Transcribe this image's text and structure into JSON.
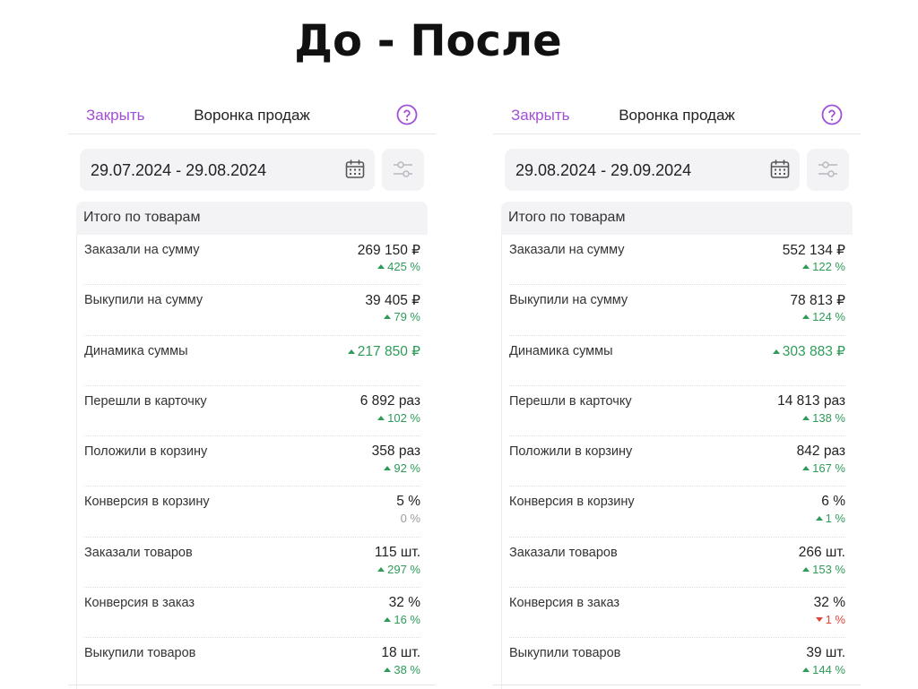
{
  "page_title": "До - После",
  "panels": [
    {
      "close_label": "Закрыть",
      "title": "Воронка продаж",
      "date_range": "29.07.2024 - 29.08.2024",
      "summary_title": "Итого по товарам",
      "rows": [
        {
          "label": "Заказали на сумму",
          "value": "269 150 ₽",
          "delta": "425 %",
          "trend": "up",
          "value_color": "normal"
        },
        {
          "label": "Выкупили на сумму",
          "value": "39 405 ₽",
          "delta": "79 %",
          "trend": "up",
          "value_color": "normal"
        },
        {
          "label": "Динамика суммы",
          "value": "217 850 ₽",
          "delta": "",
          "trend": "up",
          "value_color": "green"
        },
        {
          "label": "Перешли в карточку",
          "value": "6 892 раз",
          "delta": "102 %",
          "trend": "up",
          "value_color": "normal"
        },
        {
          "label": "Положили в корзину",
          "value": "358 раз",
          "delta": "92 %",
          "trend": "up",
          "value_color": "normal"
        },
        {
          "label": "Конверсия в корзину",
          "value": "5 %",
          "delta": "0 %",
          "trend": "none",
          "value_color": "normal"
        },
        {
          "label": "Заказали товаров",
          "value": "115 шт.",
          "delta": "297 %",
          "trend": "up",
          "value_color": "normal"
        },
        {
          "label": "Конверсия в заказ",
          "value": "32 %",
          "delta": "16 %",
          "trend": "up",
          "value_color": "normal"
        },
        {
          "label": "Выкупили товаров",
          "value": "18 шт.",
          "delta": "38 %",
          "trend": "up",
          "value_color": "normal"
        }
      ]
    },
    {
      "close_label": "Закрыть",
      "title": "Воронка продаж",
      "date_range": "29.08.2024 - 29.09.2024",
      "summary_title": "Итого по товарам",
      "rows": [
        {
          "label": "Заказали на сумму",
          "value": "552 134 ₽",
          "delta": "122 %",
          "trend": "up",
          "value_color": "normal"
        },
        {
          "label": "Выкупили на сумму",
          "value": "78 813 ₽",
          "delta": "124 %",
          "trend": "up",
          "value_color": "normal"
        },
        {
          "label": "Динамика суммы",
          "value": "303 883 ₽",
          "delta": "",
          "trend": "up",
          "value_color": "green"
        },
        {
          "label": "Перешли в карточку",
          "value": "14 813 раз",
          "delta": "138 %",
          "trend": "up",
          "value_color": "normal"
        },
        {
          "label": "Положили в корзину",
          "value": "842 раз",
          "delta": "167 %",
          "trend": "up",
          "value_color": "normal"
        },
        {
          "label": "Конверсия в корзину",
          "value": "6 %",
          "delta": "1 %",
          "trend": "up",
          "value_color": "normal"
        },
        {
          "label": "Заказали товаров",
          "value": "266 шт.",
          "delta": "153 %",
          "trend": "up",
          "value_color": "normal"
        },
        {
          "label": "Конверсия в заказ",
          "value": "32 %",
          "delta": "1 %",
          "trend": "down",
          "value_color": "normal"
        },
        {
          "label": "Выкупили товаров",
          "value": "39 шт.",
          "delta": "144 %",
          "trend": "up",
          "value_color": "normal"
        }
      ]
    }
  ],
  "colors": {
    "accent": "#a24fd6",
    "positive": "#2e9b59",
    "negative": "#e0453d",
    "neutral": "#9a9aa0",
    "field_bg": "#f3f3f6"
  },
  "icons": {
    "help": "question-circle-icon",
    "calendar": "calendar-icon",
    "filter": "sliders-icon"
  }
}
